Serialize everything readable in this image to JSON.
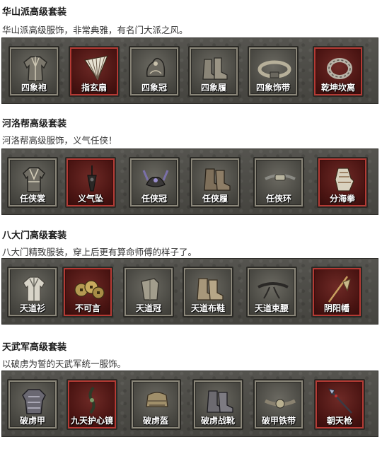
{
  "sections": [
    {
      "title": "华山派高级套装",
      "desc": "华山派高级服饰，非常典雅，有名门大派之风。",
      "items": [
        {
          "label": "四象袍",
          "icon": "robe-icon",
          "rarity": "normal"
        },
        {
          "label": "指玄扇",
          "icon": "fan-icon",
          "rarity": "rare"
        },
        {
          "label": "四象冠",
          "icon": "headpiece-icon",
          "rarity": "normal"
        },
        {
          "label": "四象履",
          "icon": "boots-icon",
          "rarity": "normal"
        },
        {
          "label": "四象饰带",
          "icon": "belt-icon",
          "rarity": "normal"
        },
        {
          "label": "乾坤坎离",
          "icon": "bracelet-icon",
          "rarity": "rare"
        }
      ]
    },
    {
      "title": "河洛帮高级套装",
      "desc": "河洛帮高级服饰，义气任侠！",
      "items": [
        {
          "label": "任侠裳",
          "icon": "robe-icon",
          "rarity": "normal"
        },
        {
          "label": "义气坠",
          "icon": "pendant-icon",
          "rarity": "rare"
        },
        {
          "label": "任侠冠",
          "icon": "headpiece-icon",
          "rarity": "normal"
        },
        {
          "label": "任侠履",
          "icon": "boots-icon",
          "rarity": "normal"
        },
        {
          "label": "任侠环",
          "icon": "belt-icon",
          "rarity": "normal"
        },
        {
          "label": "分海拳",
          "icon": "gauntlet-icon",
          "rarity": "rare"
        }
      ]
    },
    {
      "title": "八大门高级套装",
      "desc": "八大门精致服装，穿上后更有算命师傅的样子了。",
      "items": [
        {
          "label": "天道衫",
          "icon": "robe-icon",
          "rarity": "normal"
        },
        {
          "label": "不可言",
          "icon": "coins-icon",
          "rarity": "rare"
        },
        {
          "label": "天道冠",
          "icon": "headpiece-icon",
          "rarity": "normal"
        },
        {
          "label": "天道布鞋",
          "icon": "boots-icon",
          "rarity": "normal"
        },
        {
          "label": "天道束腰",
          "icon": "belt-icon",
          "rarity": "normal"
        },
        {
          "label": "阴阳幡",
          "icon": "banner-icon",
          "rarity": "rare"
        }
      ]
    },
    {
      "title": "天武军高级套装",
      "desc": "以破虏为誓的天武军统一服饰。",
      "items": [
        {
          "label": "破虏甲",
          "icon": "armor-icon",
          "rarity": "normal"
        },
        {
          "label": "九天护心镜",
          "icon": "pendant-icon",
          "rarity": "rare"
        },
        {
          "label": "破虏盔",
          "icon": "helmet-icon",
          "rarity": "normal"
        },
        {
          "label": "破虏战靴",
          "icon": "boots-icon",
          "rarity": "normal"
        },
        {
          "label": "破甲铁带",
          "icon": "belt-icon",
          "rarity": "normal"
        },
        {
          "label": "朝天枪",
          "icon": "spear-icon",
          "rarity": "rare"
        }
      ]
    }
  ]
}
